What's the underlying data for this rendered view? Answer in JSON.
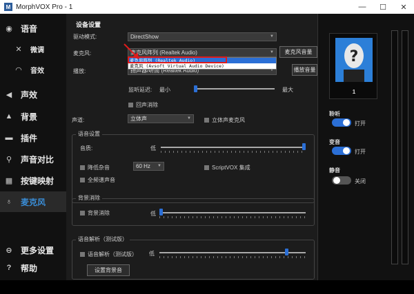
{
  "window": {
    "title": "MorphVOX Pro - 1",
    "minimize": "—",
    "maximize": "☐",
    "close": "✕"
  },
  "sidebar": {
    "items": [
      {
        "label": "语音",
        "icon": "voice-icon"
      },
      {
        "label": "微调",
        "icon": "tweak-icon"
      },
      {
        "label": "音效",
        "icon": "lips-icon"
      },
      {
        "label": "声效",
        "icon": "speaker-icon"
      },
      {
        "label": "背景",
        "icon": "background-icon"
      },
      {
        "label": "插件",
        "icon": "plugin-icon"
      },
      {
        "label": "声音对比",
        "icon": "compare-icon"
      },
      {
        "label": "按键映射",
        "icon": "keymap-icon"
      },
      {
        "label": "麦克风",
        "icon": "microphone-icon"
      },
      {
        "label": "更多设置",
        "icon": "more-icon"
      },
      {
        "label": "帮助",
        "icon": "help-icon"
      }
    ]
  },
  "device": {
    "title": "设备设置",
    "driver_label": "驱动模式:",
    "driver_value": "DirectShow",
    "mic_label": "麦克风:",
    "mic_value": "麦克风阵列 (Realtek Audio)",
    "mic_options": [
      "麦克风阵列 (Realtek Audio)",
      "麦克风 (Avsoft Virtual Audio Device)"
    ],
    "mic_button": "麦克风音量",
    "playback_label": "播放:",
    "playback_value": "扬声器/听筒 (Realtek Audio)",
    "playback_button": "播放音量",
    "latency_label": "监听延迟:",
    "latency_min": "最小",
    "latency_max": "最大",
    "latency_level": 0.0,
    "echo_cancel": "回声消除",
    "channel_label": "声道:",
    "channel_value": "立体声",
    "stereo_mic": "立体声麦克风"
  },
  "voice_settings": {
    "title": "语音设置",
    "quality_label": "音质:",
    "quality_low": "低",
    "quality_level": 1.0,
    "noise_reduce": "降低杂音",
    "noise_freq": "60 Hz",
    "scriptvox": "ScriptVOX 集成",
    "full_quiet": "全频谱声音"
  },
  "bg_cancel": {
    "title": "背景消除",
    "label": "背景消除",
    "low": "低",
    "level": 0.0
  },
  "parsing": {
    "title": "语音解析（测试版）",
    "label": "语音解析（测试版）",
    "low": "低",
    "level": 0.88,
    "button": "设置背景音"
  },
  "right_panel": {
    "voice_number": "1",
    "listen_title": "聆听",
    "listen_state": "打开",
    "morph_title": "变音",
    "morph_state": "打开",
    "mute_title": "静音",
    "mute_state": "关闭",
    "on_color": "#2b6fd6",
    "off_color": "#555555"
  }
}
